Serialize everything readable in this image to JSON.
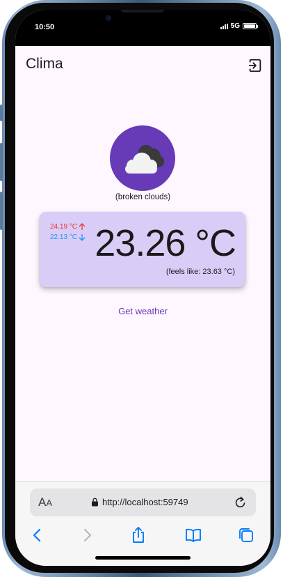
{
  "status_bar": {
    "time": "10:50",
    "network": "5G",
    "battery_level": 1.0
  },
  "app_bar": {
    "title": "Clima",
    "logout_icon": "logout-icon"
  },
  "weather": {
    "icon": "broken-clouds-icon",
    "description": "(broken clouds)",
    "temp_max": "24.19 °C",
    "temp_min": "22.13 °C",
    "temp_current": "23.26 °C",
    "feels_like": "(feels like: 23.63 °C)",
    "max_color": "#e53935",
    "min_color": "#2196f3"
  },
  "actions": {
    "get_weather_label": "Get weather"
  },
  "browser": {
    "text_size_label_big": "A",
    "text_size_label_small": "A",
    "url": "http://localhost:59749",
    "toolbar_icons": [
      "back-icon",
      "forward-icon",
      "share-icon",
      "bookmarks-icon",
      "tabs-icon"
    ]
  },
  "colors": {
    "accent": "#673ab7",
    "card_bg": "#d9ccf7",
    "screen_bg": "#fef7ff"
  }
}
